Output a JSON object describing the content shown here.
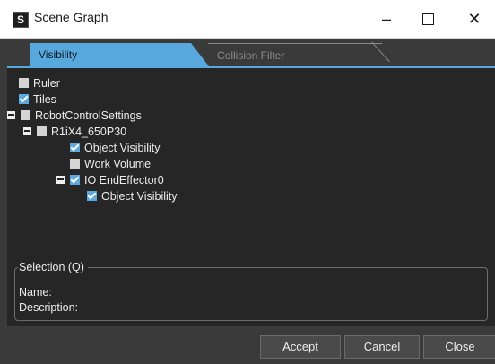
{
  "window": {
    "title": "Scene Graph",
    "app_icon_glyph": "S",
    "controls": {
      "minimize": "–",
      "close": "✕"
    }
  },
  "tabs": [
    {
      "label": "Visibility",
      "active": true
    },
    {
      "label": "Collision Filter",
      "active": false
    }
  ],
  "tree": [
    {
      "label": "Ruler",
      "checked": false,
      "expandable": false
    },
    {
      "label": "Tiles",
      "checked": true,
      "expandable": false
    },
    {
      "label": "RobotControlSettings",
      "checked": false,
      "expandable": true
    },
    {
      "label": "R1iX4_650P30",
      "checked": false,
      "expandable": true
    },
    {
      "label": "Object Visibility",
      "checked": true,
      "expandable": false
    },
    {
      "label": "Work Volume",
      "checked": false,
      "expandable": false
    },
    {
      "label": "IO EndEffector0",
      "checked": true,
      "expandable": true
    },
    {
      "label": "Object Visibility",
      "checked": true,
      "expandable": false
    }
  ],
  "selection": {
    "legend": "Selection (Q)",
    "name_label": "Name:",
    "description_label": "Description:"
  },
  "buttons": {
    "accept": "Accept",
    "cancel": "Cancel",
    "close": "Close"
  },
  "colors": {
    "accent": "#57a9dd",
    "panel_bg": "#262626",
    "window_bg": "#3a3a3a",
    "text": "#ececec"
  }
}
